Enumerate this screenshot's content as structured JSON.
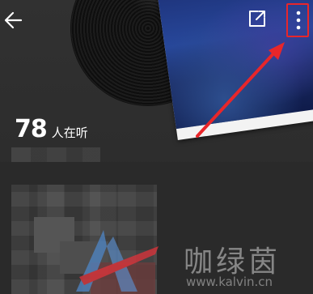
{
  "header": {
    "back_icon": "arrow-left-icon",
    "share_icon": "share-external-icon",
    "more_icon": "more-vertical-icon"
  },
  "listeners": {
    "count": "78",
    "label": "人在听"
  },
  "annotation": {
    "highlight_color": "#e8262a",
    "arrow_color": "#e8262a"
  },
  "watermark": {
    "text": "咖绿茵",
    "url": "www.kalvin.cn"
  },
  "colors": {
    "background": "#2b2b2b",
    "text": "#ffffff"
  }
}
